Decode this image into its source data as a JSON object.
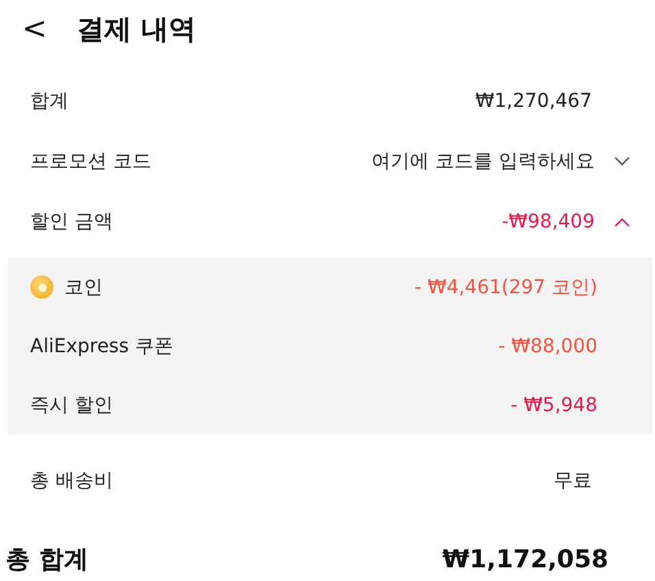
{
  "header": {
    "back": "<",
    "title": "결제 내역"
  },
  "summary": {
    "label": "합계",
    "value": "₩1,270,467"
  },
  "promo": {
    "label": "프로모션 코드",
    "placeholder": "여기에 코드를 입력하세요",
    "expanded": false
  },
  "discount": {
    "label": "할인 금액",
    "value": "-₩98,409",
    "expanded": true,
    "color": "#e8194b"
  },
  "discount_items": [
    {
      "kind": "coin",
      "label": "코인",
      "value": "- ₩4,461(297 코인)",
      "color": "#f4533d"
    },
    {
      "kind": "plain",
      "label": "AliExpress 쿠폰",
      "value": "- ₩88,000",
      "color": "#f4533d"
    },
    {
      "kind": "plain",
      "label": "즉시 할인",
      "value": "- ₩5,948",
      "color": "#e8194b"
    }
  ],
  "shipping": {
    "label": "총 배송비",
    "value": "무료"
  },
  "total": {
    "label": "총 합계",
    "value": "₩1,172,058"
  }
}
